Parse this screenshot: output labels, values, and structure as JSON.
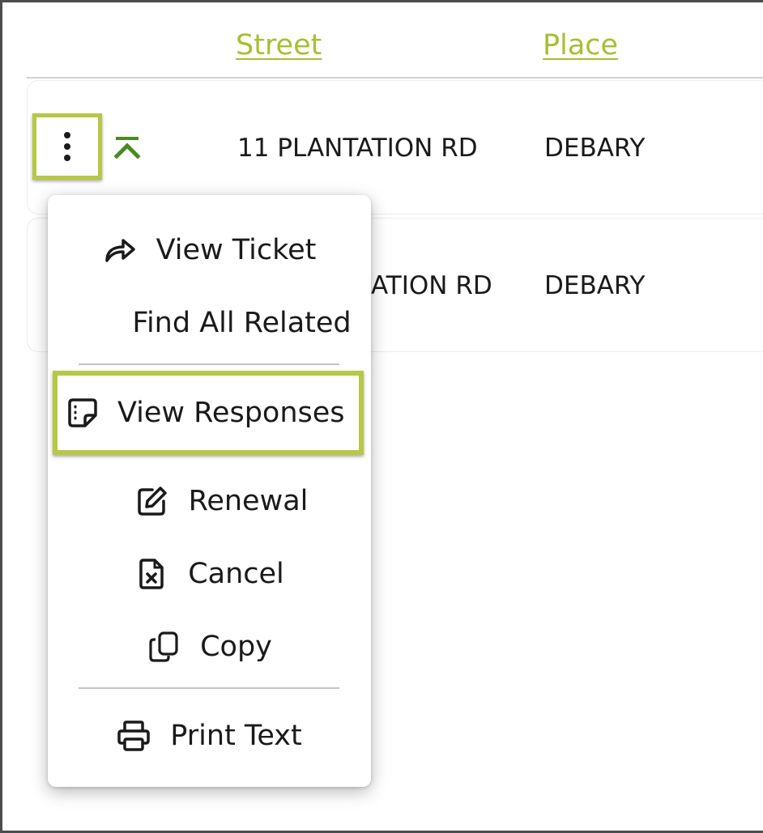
{
  "table": {
    "columns": [
      "Street",
      "Place"
    ],
    "rows": [
      {
        "street": "11 PLANTATION RD",
        "place": "DEBARY"
      },
      {
        "street_visible": "ATION RD",
        "place": "DEBARY"
      }
    ]
  },
  "menu": {
    "items": [
      {
        "label": "View Ticket",
        "icon": "share-arrow-icon"
      },
      {
        "label": "Find All Related",
        "icon": ""
      },
      {
        "label": "View Responses",
        "icon": "sticky-note-icon"
      },
      {
        "label": "Renewal",
        "icon": "edit-icon"
      },
      {
        "label": "Cancel",
        "icon": "file-x-icon"
      },
      {
        "label": "Copy",
        "icon": "copy-icon"
      },
      {
        "label": "Print Text",
        "icon": "printer-icon"
      }
    ]
  },
  "colors": {
    "accent": "#a8bf32",
    "highlight_border": "#b6c845",
    "collapse_icon": "#4a8a22"
  }
}
